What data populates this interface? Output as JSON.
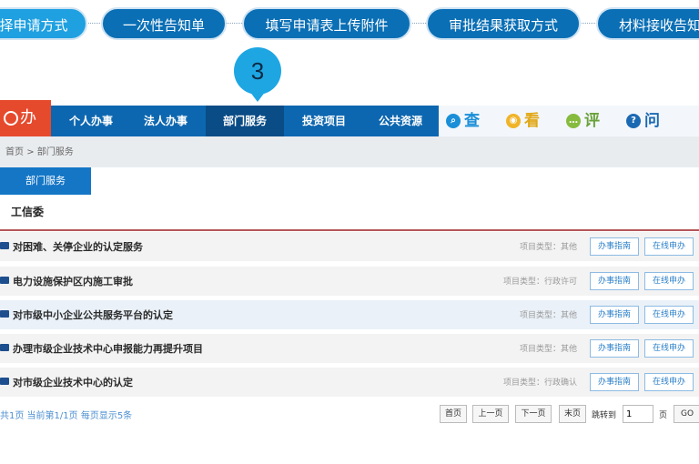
{
  "steps": [
    {
      "label": "择申请方式"
    },
    {
      "label": "一次性告知单"
    },
    {
      "label": "填写申请表上传附件"
    },
    {
      "label": "审批结果获取方式"
    },
    {
      "label": "材料接收告知"
    }
  ],
  "callout": {
    "number": "3"
  },
  "brand": {
    "label": "办"
  },
  "nav": {
    "items": [
      "个人办事",
      "法人办事",
      "部门服务",
      "投资项目",
      "公共资源"
    ],
    "active": "部门服务"
  },
  "quick": [
    {
      "label": "查",
      "icon": "search-icon"
    },
    {
      "label": "看",
      "icon": "view-icon"
    },
    {
      "label": "评",
      "icon": "comment-icon"
    },
    {
      "label": "问",
      "icon": "question-icon"
    }
  ],
  "breadcrumb": {
    "home": "首页",
    "separator": ">",
    "current": "部门服务"
  },
  "dept_tab": {
    "label": "部门服务"
  },
  "section": {
    "title": "工信委"
  },
  "list": [
    {
      "title": "对困难、关停企业的认定服务",
      "type": "项目类型：其他",
      "guide": "办事指南",
      "apply": "在线申办"
    },
    {
      "title": "电力设施保护区内施工审批",
      "type": "项目类型：行政许可",
      "guide": "办事指南",
      "apply": "在线申办"
    },
    {
      "title": "对市级中小企业公共服务平台的认定",
      "type": "项目类型：其他",
      "guide": "办事指南",
      "apply": "在线申办"
    },
    {
      "title": "办理市级企业技术中心申报能力再提升项目",
      "type": "项目类型：其他",
      "guide": "办事指南",
      "apply": "在线申办"
    },
    {
      "title": "对市级企业技术中心的认定",
      "type": "项目类型：行政确认",
      "guide": "办事指南",
      "apply": "在线申办"
    }
  ],
  "pager": {
    "info": "共1页  当前第1/1页  每页显示5条",
    "first": "首页",
    "prev": "上一页",
    "next": "下一页",
    "last": "末页",
    "jump_label": "跳转到",
    "jump_value": "1",
    "page_unit": "页",
    "go": "GO"
  }
}
